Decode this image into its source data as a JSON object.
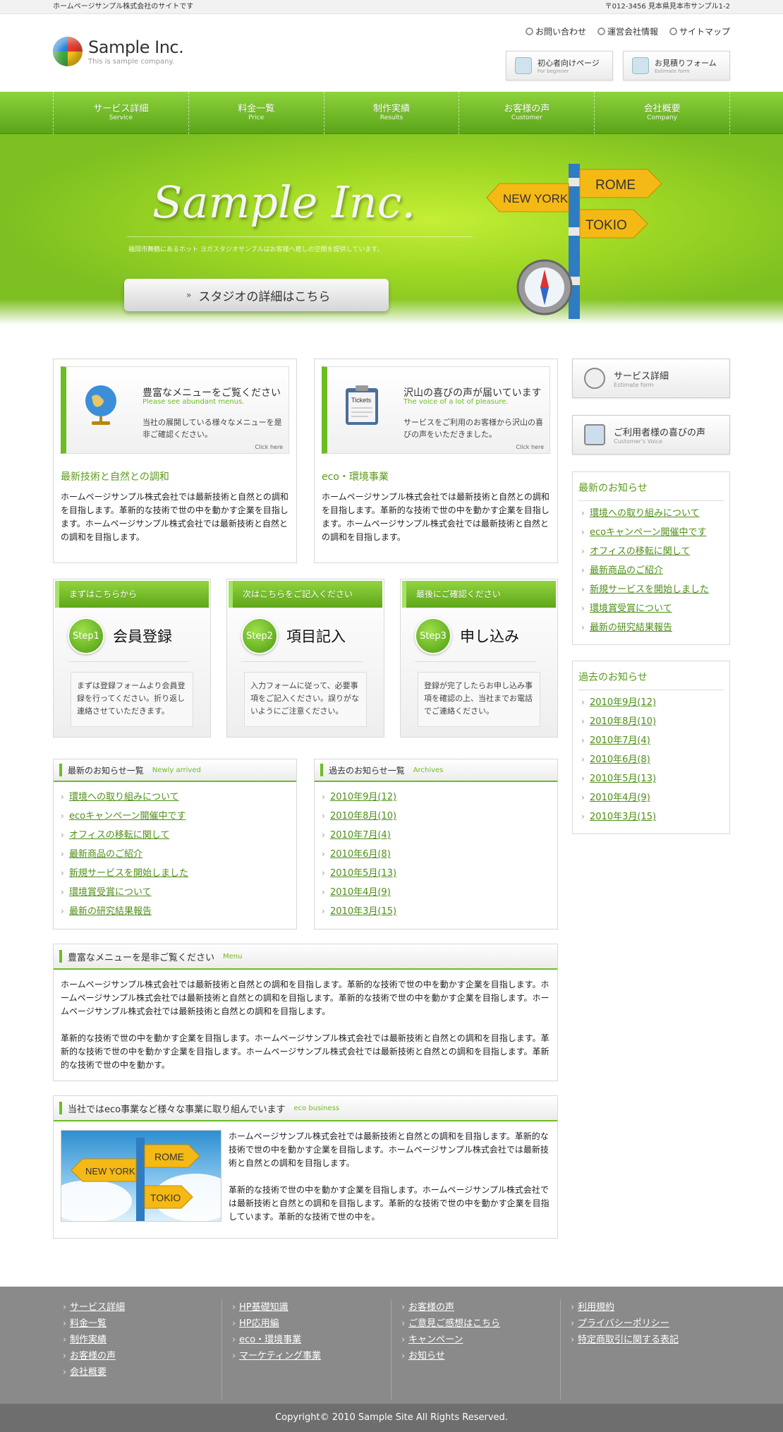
{
  "topbar": {
    "left": "ホームページサンプル株式会社のサイトです",
    "right": "〒012-3456 見本県見本市サンプル1-2"
  },
  "logo": {
    "name": "Sample Inc.",
    "tagline": "This is sample company."
  },
  "header_links": [
    "お問い合わせ",
    "運営会社情報",
    "サイトマップ"
  ],
  "header_buttons": [
    {
      "title": "初心者向けページ",
      "sub": "For beginner"
    },
    {
      "title": "お見積りフォーム",
      "sub": "Estimate form"
    }
  ],
  "nav": [
    {
      "ja": "サービス詳細",
      "en": "Service"
    },
    {
      "ja": "料金一覧",
      "en": "Price"
    },
    {
      "ja": "制作実績",
      "en": "Results"
    },
    {
      "ja": "お客様の声",
      "en": "Customer"
    },
    {
      "ja": "会社概要",
      "en": "Company"
    }
  ],
  "hero": {
    "title": "Sample Inc.",
    "subtitle": "福岡市舞鶴にあるホット ヨガスタジオサンプルはお客様へ癒しの空間を提供しています。",
    "button": "スタジオの詳細はこちら",
    "signs": [
      "NEW YORK",
      "ROME",
      "TOKIO"
    ]
  },
  "features": [
    {
      "banner_title": "豊富なメニューをご覧ください",
      "banner_en": "Please see abundant menus.",
      "banner_text": "当社の展開している様々なメニューを是非ご確認ください。",
      "click": "Click here",
      "heading": "最新技術と自然との調和",
      "body": "ホームページサンプル株式会社では最新技術と自然との調和を目指します。革新的な技術で世の中を動かす企業を目指します。ホームページサンプル株式会社では最新技術と自然との調和を目指します。"
    },
    {
      "banner_title": "沢山の喜びの声が届いています",
      "banner_en": "The voice of a lot of pleasure.",
      "banner_text": "サービスをご利用のお客様から沢山の喜びの声をいただきました。",
      "click": "Click here",
      "ticket": "Tickets",
      "heading": "eco・環境事業",
      "body": "ホームページサンプル株式会社では最新技術と自然との調和を目指します。革新的な技術で世の中を動かす企業を目指します。ホームページサンプル株式会社では最新技術と自然との調和を目指します。"
    }
  ],
  "steps": [
    {
      "header": "まずはこちらから",
      "step": "Step1",
      "title": "会員登録",
      "text": "まずは登録フォームより会員登録を行ってください。折り返し連絡させていただきます。"
    },
    {
      "header": "次はこちらをご記入ください",
      "step": "Step2",
      "title": "項目記入",
      "text": "入力フォームに従って、必要事項をご記入ください。誤りがないようにご注意ください。"
    },
    {
      "header": "最後にご確認ください",
      "step": "Step3",
      "title": "申し込み",
      "text": "登録が完了したらお申し込み事項を確認の上、当社までお電話でご連絡ください。"
    }
  ],
  "news": {
    "title": "最新のお知らせ一覧",
    "en": "Newly arrived",
    "items": [
      "環境への取り組みについて",
      "ecoキャンペーン開催中です",
      "オフィスの移転に関して",
      "最新商品のご紹介",
      "新規サービスを開始しました",
      "環境賞受賞について",
      "最新の研究結果報告"
    ]
  },
  "archives": {
    "title": "過去のお知らせ一覧",
    "en": "Archives",
    "items": [
      "2010年9月(12)",
      "2010年8月(10)",
      "2010年7月(4)",
      "2010年6月(8)",
      "2010年5月(13)",
      "2010年4月(9)",
      "2010年3月(15)"
    ]
  },
  "menu_box": {
    "title": "豊富なメニューを是非ご覧ください",
    "en": "Menu",
    "p1": "ホームページサンプル株式会社では最新技術と自然との調和を目指します。革新的な技術で世の中を動かす企業を目指します。ホームページサンプル株式会社では最新技術と自然との調和を目指します。革新的な技術で世の中を動かす企業を目指します。ホームページサンプル株式会社では最新技術と自然との調和を目指します。",
    "p2": "革新的な技術で世の中を動かす企業を目指します。ホームページサンプル株式会社では最新技術と自然との調和を目指します。革新的な技術で世の中を動かす企業を目指します。ホームページサンプル株式会社では最新技術と自然との調和を目指します。革新的な技術で世の中を動かす。"
  },
  "eco_box": {
    "title": "当社ではeco事業など様々な事業に取り組んでいます",
    "en": "eco business",
    "p1": "ホームページサンプル株式会社では最新技術と自然との調和を目指します。革新的な技術で世の中を動かす企業を目指します。ホームページサンプル株式会社では最新技術と自然との調和を目指します。",
    "p2": "革新的な技術で世の中を動かす企業を目指します。ホームページサンプル株式会社では最新技術と自然との調和を目指します。革新的な技術で世の中を動かす企業を目指しています。革新的な技術で世の中を。"
  },
  "side_buttons": [
    {
      "title": "サービス詳細",
      "sub": "Estimate form"
    },
    {
      "title": "ご利用者様の喜びの声",
      "sub": "Customer's Voice"
    }
  ],
  "side_news": {
    "title": "最新のお知らせ"
  },
  "side_archives": {
    "title": "過去のお知らせ"
  },
  "footer": {
    "cols": [
      [
        "サービス詳細",
        "料金一覧",
        "制作実績",
        "お客様の声",
        "会社概要"
      ],
      [
        "HP基礎知識",
        "HP応用編",
        "eco・環境事業",
        "マーケティング事業"
      ],
      [
        "お客様の声",
        "ご意見ご感想はこちら",
        "キャンペーン",
        "お知らせ"
      ],
      [
        "利用規約",
        "プライバシーポリシー",
        "特定商取引に関する表記"
      ]
    ],
    "copyright": "Copyright© 2010 Sample Site All Rights Reserved."
  },
  "colors": {
    "accent": "#6cbd22",
    "link": "#4e8f17",
    "footer": "#8a8a8a"
  }
}
